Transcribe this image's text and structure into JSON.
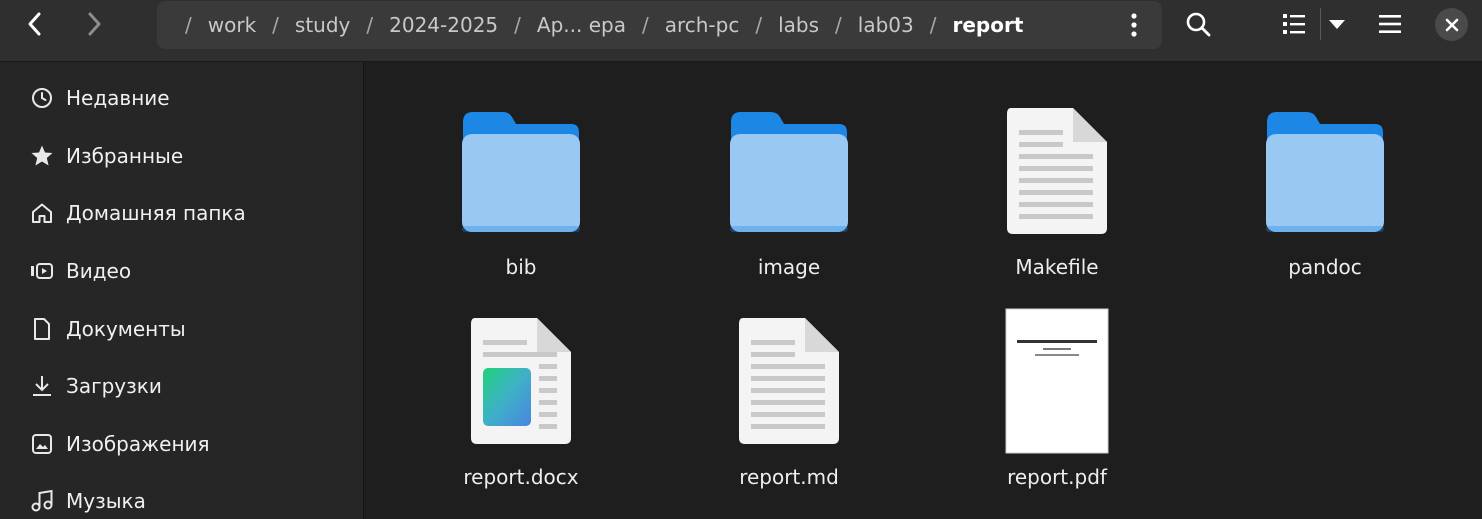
{
  "header": {
    "path": [
      {
        "label": "work"
      },
      {
        "label": "study"
      },
      {
        "label": "2024-2025"
      },
      {
        "label": "Ар... ера"
      },
      {
        "label": "arch-pc"
      },
      {
        "label": "labs"
      },
      {
        "label": "lab03"
      },
      {
        "label": "report"
      }
    ],
    "root_sep": "/"
  },
  "sidebar": {
    "items": [
      {
        "label": "Недавние",
        "icon": "clock-icon"
      },
      {
        "label": "Избранные",
        "icon": "star-icon"
      },
      {
        "label": "Домашняя папка",
        "icon": "home-icon"
      },
      {
        "label": "Видео",
        "icon": "video-icon"
      },
      {
        "label": "Документы",
        "icon": "document-icon"
      },
      {
        "label": "Загрузки",
        "icon": "download-icon"
      },
      {
        "label": "Изображения",
        "icon": "image-icon"
      },
      {
        "label": "Музыка",
        "icon": "music-icon"
      }
    ]
  },
  "files": [
    {
      "name": "bib",
      "kind": "folder"
    },
    {
      "name": "image",
      "kind": "folder"
    },
    {
      "name": "Makefile",
      "kind": "text"
    },
    {
      "name": "pandoc",
      "kind": "folder"
    },
    {
      "name": "report.docx",
      "kind": "docx"
    },
    {
      "name": "report.md",
      "kind": "text"
    },
    {
      "name": "report.pdf",
      "kind": "pdf"
    }
  ],
  "colors": {
    "folder_front": "#99c8f2",
    "folder_back": "#1c87e5",
    "header_bg": "#2f2f2f",
    "sidebar_bg": "#262626",
    "main_bg": "#1e1e1e"
  }
}
